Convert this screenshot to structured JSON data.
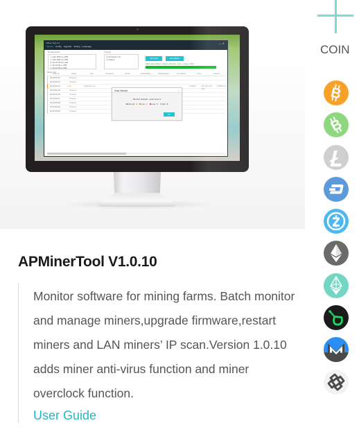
{
  "coin_panel": {
    "heading": "COIN",
    "plus_icon": "plus-icon",
    "coins": [
      {
        "name": "bitcoin",
        "icon": "bitcoin-icon",
        "color": "#F7A128"
      },
      {
        "name": "bitcoin-cash",
        "icon": "bitcoin-cash-icon",
        "color": "#8DD87E"
      },
      {
        "name": "litecoin",
        "icon": "litecoin-icon",
        "color": "#CFCFCF"
      },
      {
        "name": "dash",
        "icon": "dash-icon",
        "color": "#5B9BDB"
      },
      {
        "name": "zcash",
        "icon": "zcash-icon",
        "color": "#4CB8F0"
      },
      {
        "name": "ethereum",
        "icon": "ethereum-icon",
        "color": "#6A6A6A"
      },
      {
        "name": "ethereum-classic",
        "icon": "ethereum-classic-icon",
        "color": "#72D6C3"
      },
      {
        "name": "siacoin",
        "icon": "siacoin-icon",
        "color": "#1B1B1B"
      },
      {
        "name": "monero",
        "icon": "monero-icon",
        "color": "#2B8EF0"
      },
      {
        "name": "bytom",
        "icon": "bytom-icon",
        "color": "#F2F2F2"
      }
    ]
  },
  "product": {
    "title": "APMinerTool V1.0.10",
    "description": "Monitor software for mining farms. Batch monitor and manage miners,upgrade firmware,restart miners and LAN miners’ IP scan.Version 1.0.10 adds miner anti-virus function and miner overclock function.",
    "user_guide_label": "User Guide",
    "link_color": "#23B8C6"
  },
  "screenshot_app": {
    "window_title": "Miner Tool 1.2",
    "window_controls": "— ✕",
    "menu": [
      "Monitor",
      "Config",
      "Upgrade",
      "Setting",
      "Language"
    ],
    "ip_segments_label": "IP Segments",
    "ip_segments": [
      {
        "label": "192.168.1.1~255",
        "checked": false
      },
      {
        "label": "192.168.2.1~255",
        "checked": false
      },
      {
        "label": "10.10.54.12~120",
        "checked": true
      },
      {
        "label": "10.10.55.1~255",
        "checked": false
      },
      {
        "label": "10.10.56.1~255",
        "checked": false
      }
    ],
    "types_label": "Type(s)",
    "types": [
      {
        "label": "Antminer L3+",
        "checked": true
      },
      {
        "label": "Others",
        "checked": true
      }
    ],
    "start_scan_label": "Start Scan",
    "auto_monitor_label": "Auto Monitor",
    "scan_status": "100% Scan finished , Total 9 , Normal 0 , Low 1 , Lost 0 , Fail 8",
    "scan_progress": 1.0,
    "miner_list_label": "Miner List",
    "columns": [
      "Miner IP",
      "Status",
      "Type",
      "Frequency",
      "Version",
      "Hashrate(5s)",
      "Hashrate(avg)",
      "Fan Speed",
      "Temp",
      "Elapsed"
    ],
    "rows": [
      {
        "ip": "10.10.54.12",
        "status": "Timeout",
        "lost": false
      },
      {
        "ip": "10.10.54.13",
        "status": "Timeout",
        "lost": false
      },
      {
        "ip": "10.10.54.14",
        "status": "Lost",
        "lost": true,
        "type": "Antminer L3+",
        "fan": "| 3,000 |",
        "temp": "48 | 48 | 48 | 48 |",
        "elapsed": "14h50m1s"
      },
      {
        "ip": "10.10.54.15",
        "status": "Timeout",
        "lost": false
      },
      {
        "ip": "10.10.54.16",
        "status": "Timeout",
        "lost": false
      },
      {
        "ip": "10.10.54.17",
        "status": "Timeout",
        "lost": false
      },
      {
        "ip": "10.10.54.18",
        "status": "Timeout",
        "lost": false
      },
      {
        "ip": "10.10.54.19",
        "status": "Timeout",
        "lost": false
      },
      {
        "ip": "10.10.54.20",
        "status": "Timeout",
        "lost": false
      }
    ],
    "extra_col": "stratum",
    "dialog": {
      "title": "Scan finished",
      "message": "Monitor finished , total miner 9",
      "stats": [
        {
          "label": "Normal : 0",
          "color": "#52B52A"
        },
        {
          "label": "Low : 1",
          "color": "#F08A2C"
        },
        {
          "label": "Lost : 0",
          "color": "#E84A4A"
        },
        {
          "label": "Fail : 8",
          "color": "#BBBBBB"
        }
      ],
      "ok_label": "OK"
    }
  }
}
